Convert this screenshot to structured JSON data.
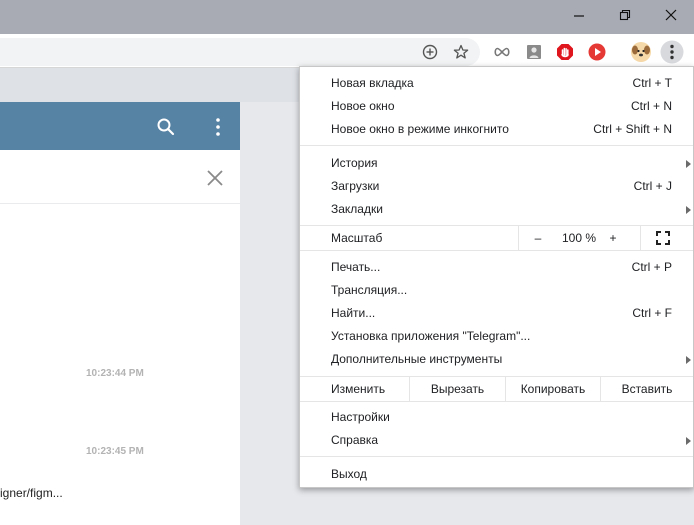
{
  "window": {
    "minimize_icon": "minimize-icon",
    "restore_icon": "restore-icon",
    "close_icon": "close-icon"
  },
  "toolbar": {
    "icons": [
      "add-circle-icon",
      "star-icon",
      "infinity-icon",
      "profile-card-icon",
      "red-hand-icon",
      "red-play-icon",
      "avatar-dog-icon",
      "kebab-menu-icon"
    ]
  },
  "telegram": {
    "times": [
      "10:23:44 PM",
      "10:23:45 PM"
    ],
    "message_snippet": "igner/figm..."
  },
  "menu": {
    "new_tab": "Новая вкладка",
    "new_tab_sc": "Ctrl + T",
    "new_window": "Новое окно",
    "new_window_sc": "Ctrl + N",
    "incognito": "Новое окно в режиме инкогнито",
    "incognito_sc": "Ctrl + Shift + N",
    "history": "История",
    "downloads": "Загрузки",
    "downloads_sc": "Ctrl + J",
    "bookmarks": "Закладки",
    "zoom_label": "Масштаб",
    "zoom_minus": "–",
    "zoom_value": "100 %",
    "zoom_plus": "+",
    "print": "Печать...",
    "print_sc": "Ctrl + P",
    "cast": "Трансляция...",
    "find": "Найти...",
    "find_sc": "Ctrl + F",
    "install": "Установка приложения \"Telegram\"...",
    "more_tools": "Дополнительные инструменты",
    "edit_label": "Изменить",
    "cut": "Вырезать",
    "copy": "Копировать",
    "paste": "Вставить",
    "settings": "Настройки",
    "help": "Справка",
    "exit": "Выход"
  },
  "colors": {
    "titlebar": "#a8abb4",
    "telegram_header": "#5682a3",
    "ublock_red": "#e0161f",
    "play_red": "#e53935"
  }
}
